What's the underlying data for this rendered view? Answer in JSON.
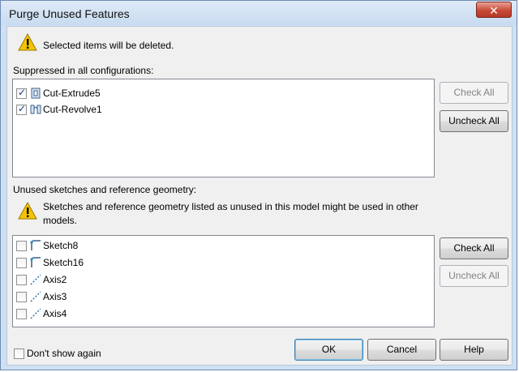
{
  "window": {
    "title": "Purge Unused Features",
    "close_glyph": "✕"
  },
  "warning_top": {
    "icon": "warning-icon",
    "text": "Selected items will be deleted."
  },
  "suppressed_section": {
    "label": "Suppressed in all configurations:",
    "items": [
      {
        "label": "Cut-Extrude5",
        "checked": true,
        "icon": "cut-extrude-icon"
      },
      {
        "label": "Cut-Revolve1",
        "checked": true,
        "icon": "cut-revolve-icon"
      }
    ],
    "check_all": "Check All",
    "uncheck_all": "Uncheck All"
  },
  "unused_section": {
    "label": "Unused sketches and reference geometry:",
    "warning_text": "Sketches and reference geometry listed as unused in this model might be used in other models.",
    "items": [
      {
        "label": "Sketch8",
        "checked": false,
        "icon": "sketch-icon"
      },
      {
        "label": "Sketch16",
        "checked": false,
        "icon": "sketch-icon"
      },
      {
        "label": "Axis2",
        "checked": false,
        "icon": "axis-icon"
      },
      {
        "label": "Axis3",
        "checked": false,
        "icon": "axis-icon"
      },
      {
        "label": "Axis4",
        "checked": false,
        "icon": "axis-icon"
      }
    ],
    "check_all": "Check All",
    "uncheck_all": "Uncheck All"
  },
  "footer": {
    "dont_show": "Don't show again",
    "ok": "OK",
    "cancel": "Cancel",
    "help": "Help"
  },
  "colors": {
    "title_bg": "#cfe0f3",
    "close_red": "#c84a36",
    "warning_yellow": "#f5c400",
    "check_blue": "#1a3e84"
  }
}
